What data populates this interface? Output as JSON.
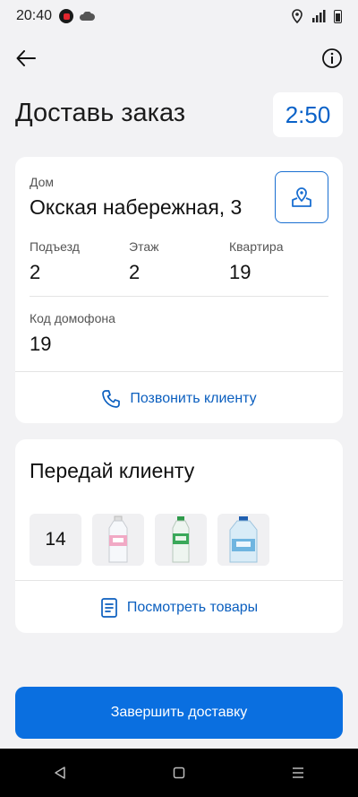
{
  "status_bar": {
    "time": "20:40"
  },
  "header": {
    "title": "Доставь заказ",
    "timer": "2:50"
  },
  "address_card": {
    "house_label": "Дом",
    "house_value": "Окская набережная, 3",
    "entrance_label": "Подъезд",
    "entrance_value": "2",
    "floor_label": "Этаж",
    "floor_value": "2",
    "apartment_label": "Квартира",
    "apartment_value": "19",
    "intercom_label": "Код домофона",
    "intercom_value": "19",
    "call_label": "Позвонить клиенту"
  },
  "handover_card": {
    "title": "Передай клиенту",
    "items_count": "14",
    "view_goods_label": "Посмотреть товары"
  },
  "footer": {
    "complete_label": "Завершить доставку"
  },
  "colors": {
    "accent": "#0a6fe0",
    "link": "#0b5fbf",
    "background": "#f2f2f4"
  }
}
